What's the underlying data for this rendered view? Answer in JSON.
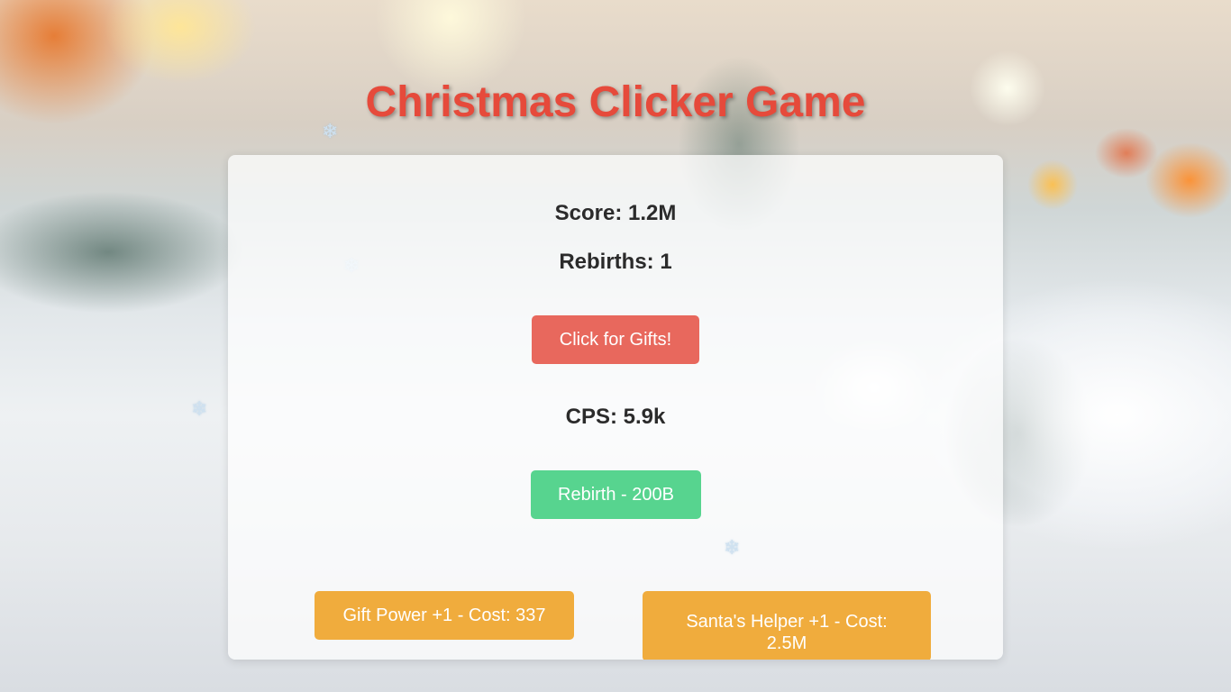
{
  "header": {
    "title": "Christmas Clicker Game"
  },
  "stats": {
    "score": "Score: 1.2M",
    "rebirths": "Rebirths: 1",
    "cps": "CPS: 5.9k"
  },
  "buttons": {
    "click_label": "Click for Gifts!",
    "rebirth_label": "Rebirth - 200B"
  },
  "upgrades": [
    {
      "label": "Gift Power +1 - Cost: 337"
    },
    {
      "label": "Santa's Helper +1 - Cost: 2.5M"
    }
  ],
  "decor": {
    "snowflake_glyph": "❄"
  },
  "colors": {
    "title": "#e64a3b",
    "click_button": "#e8685d",
    "rebirth_button": "#57d48f",
    "upgrade_button": "#f0ac3d"
  }
}
